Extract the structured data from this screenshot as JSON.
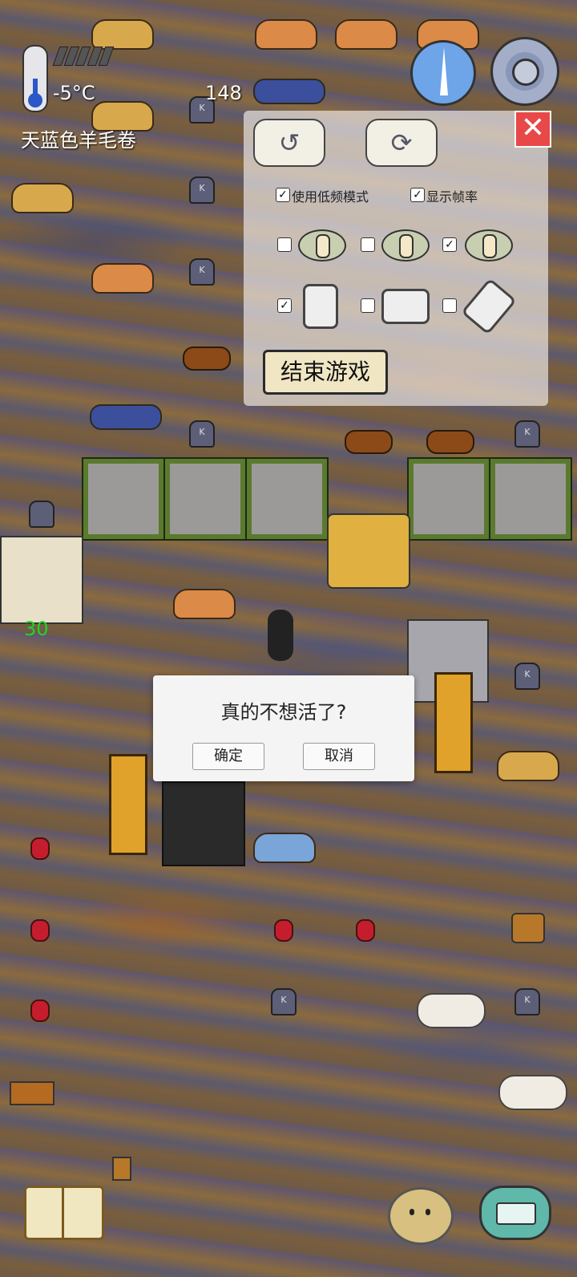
{
  "hud": {
    "temperature": "-5°C",
    "age_counter": "148",
    "held_item": "天蓝色羊毛卷",
    "fps": "30"
  },
  "settings": {
    "low_freq_mode_label": "使用低频模式",
    "low_freq_mode_checked": true,
    "show_fps_label": "显示帧率",
    "show_fps_checked": true,
    "view_options_checked": [
      false,
      false,
      true
    ],
    "orientation_options_checked": [
      true,
      false,
      false
    ],
    "end_game_label": "结束游戏",
    "close_symbol": "✕"
  },
  "dialog": {
    "message": "真的不想活了?",
    "confirm_label": "确定",
    "cancel_label": "取消"
  },
  "icons": {
    "thermometer": "thermometer-icon",
    "compass": "compass-icon",
    "settings": "gear-icon",
    "book": "book-icon",
    "emote": "emote-face-icon",
    "keyboard": "keyboard-icon"
  }
}
